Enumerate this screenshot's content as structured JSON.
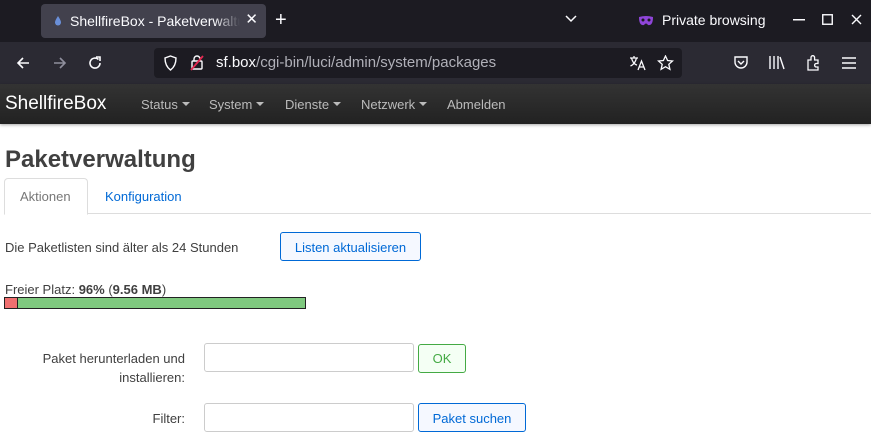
{
  "browser": {
    "tab_title": "ShellfireBox - Paketverwaltung",
    "tab_close": "✕",
    "new_tab": "+",
    "private_label": "Private browsing",
    "url_host": "sf.box",
    "url_path": "/cgi-bin/luci/admin/system/packages"
  },
  "header": {
    "brand": "ShellfireBox",
    "menu": [
      "Status",
      "System",
      "Dienste",
      "Netzwerk",
      "Abmelden"
    ]
  },
  "page": {
    "title": "Paketverwaltung",
    "tabs": [
      "Aktionen",
      "Konfiguration"
    ],
    "lists_status": "Die Paketlisten sind älter als 24 Stunden",
    "update_button": "Listen aktualisieren",
    "free_space_label": "Freier Platz: ",
    "free_percent": "96%",
    "free_size_open": " (",
    "free_size": "9.56 MB",
    "free_size_close": ")",
    "free_space_fraction": 0.96,
    "download_label": "Paket herunterladen und installieren:",
    "download_value": "",
    "ok_button": "OK",
    "filter_label": "Filter:",
    "filter_value": "",
    "search_button": "Paket suchen"
  },
  "colors": {
    "used": "#f07070",
    "free": "#7fc97f",
    "link": "#0069d6"
  }
}
